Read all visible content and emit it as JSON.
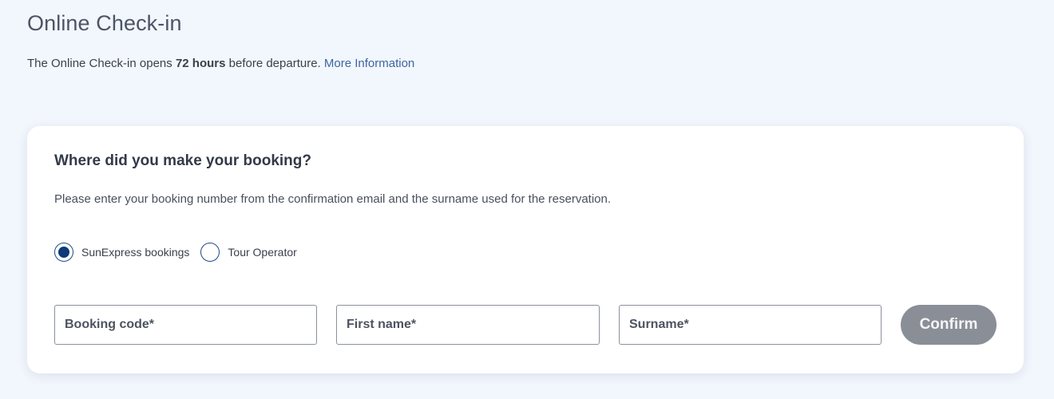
{
  "header": {
    "title": "Online Check-in",
    "intro_prefix": "The Online Check-in opens ",
    "intro_bold": "72 hours",
    "intro_suffix": " before departure. ",
    "more_info_link": "More Information"
  },
  "booking_card": {
    "title": "Where did you make your booking?",
    "description": "Please enter your booking number from the confirmation email and the surname used for the reservation.",
    "radio_options": [
      {
        "label": "SunExpress bookings",
        "selected": true
      },
      {
        "label": "Tour Operator",
        "selected": false
      }
    ],
    "fields": {
      "booking_code": {
        "placeholder": "Booking code*",
        "value": ""
      },
      "first_name": {
        "placeholder": "First name*",
        "value": ""
      },
      "surname": {
        "placeholder": "Surname*",
        "value": ""
      }
    },
    "confirm_label": "Confirm"
  },
  "colors": {
    "background": "#f2f6fd",
    "link": "#3c66a0",
    "radio_selected": "#0d3a78",
    "button_disabled": "#8a8e97"
  }
}
